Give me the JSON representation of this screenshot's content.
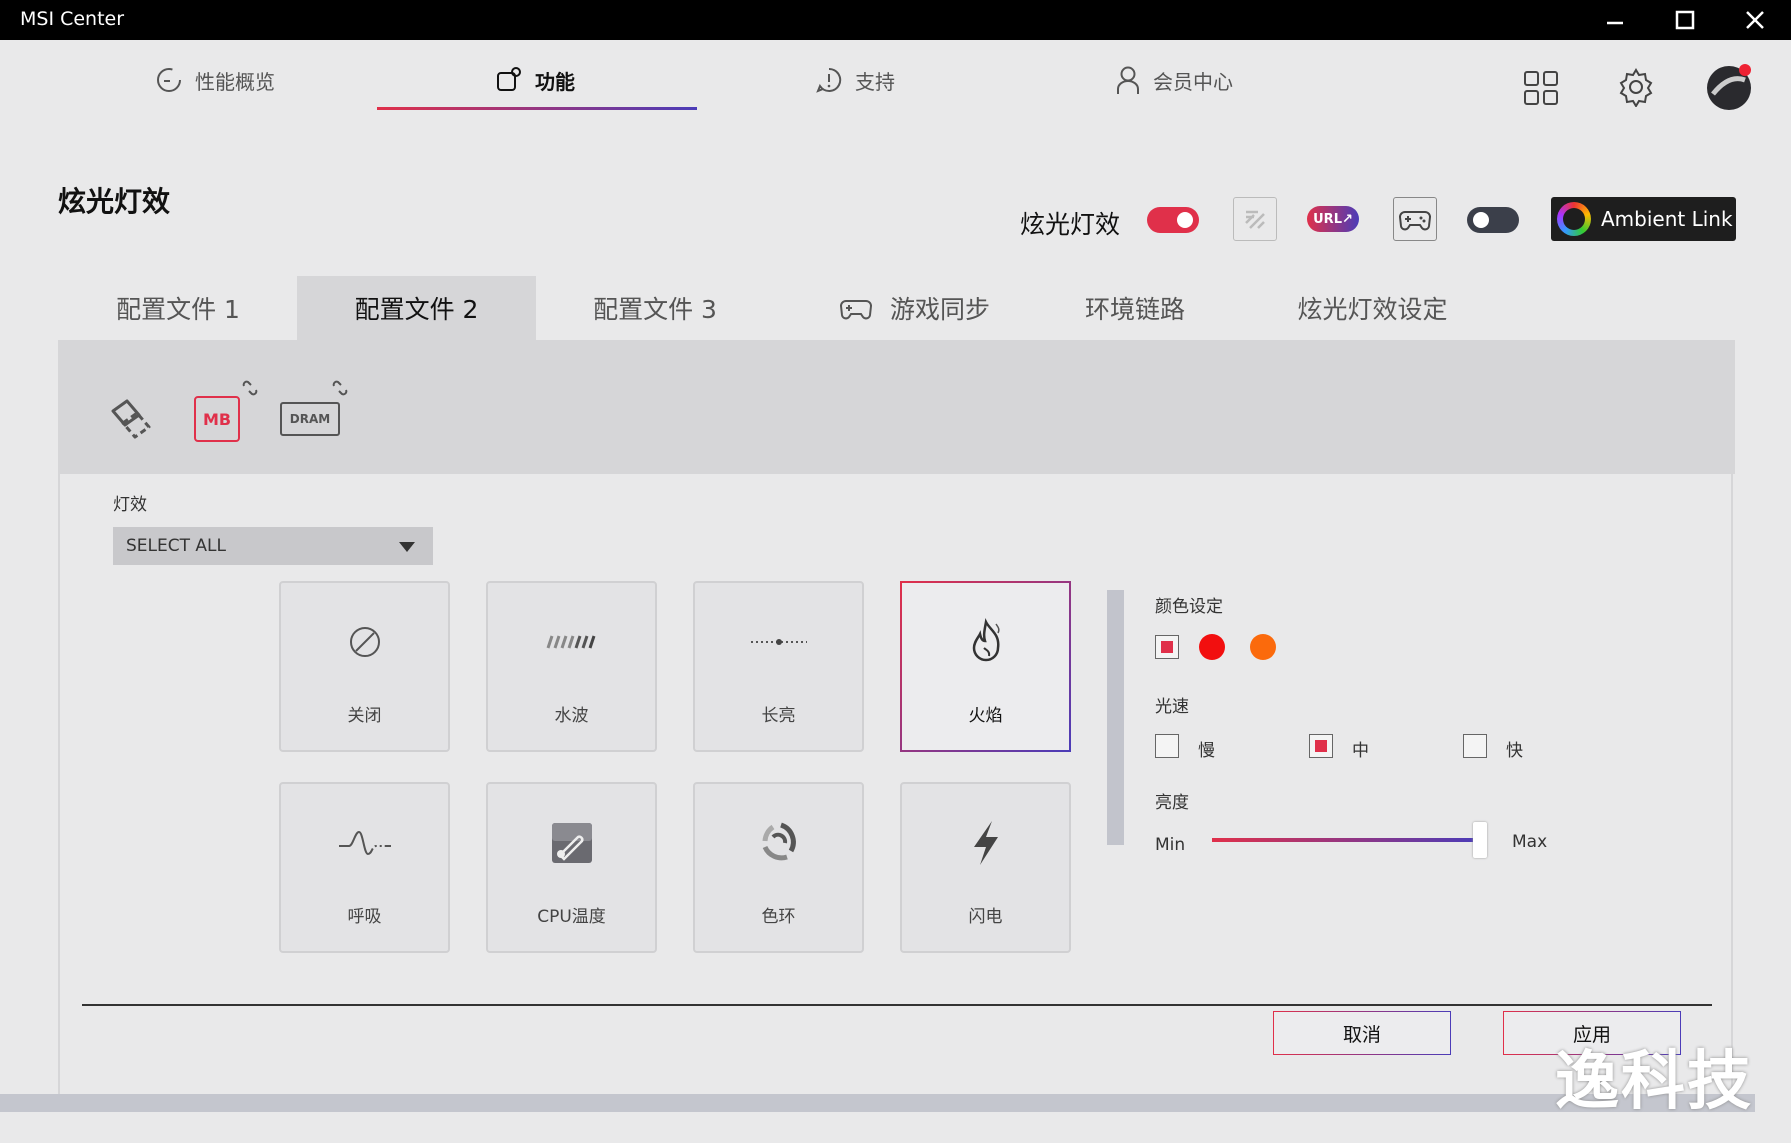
{
  "window": {
    "title": "MSI Center"
  },
  "nav": {
    "items": [
      {
        "label": "性能概览"
      },
      {
        "label": "功能"
      },
      {
        "label": "支持"
      },
      {
        "label": "会员中心"
      }
    ],
    "active_index": 1
  },
  "header": {
    "title": "炫光灯效",
    "toggle_label": "炫光灯效",
    "lighting_enabled": true,
    "second_toggle_enabled": false,
    "url_badge": "URL↗",
    "ambient_link_label": "Ambient Link"
  },
  "tabs": [
    {
      "label": "配置文件 1"
    },
    {
      "label": "配置文件 2"
    },
    {
      "label": "配置文件 3"
    },
    {
      "label": "游戏同步"
    },
    {
      "label": "环境链路"
    },
    {
      "label": "炫光灯效设定"
    }
  ],
  "active_tab_index": 1,
  "devices": [
    {
      "icon": "link-devices-icon"
    },
    {
      "icon": "motherboard-icon",
      "text": "MB"
    },
    {
      "icon": "dram-icon",
      "text": "DRAM"
    }
  ],
  "effects_section": {
    "label": "灯效",
    "select_value": "SELECT ALL",
    "effects": [
      {
        "label": "关闭",
        "icon": "off-icon"
      },
      {
        "label": "水波",
        "icon": "wave-icon"
      },
      {
        "label": "长亮",
        "icon": "steady-icon"
      },
      {
        "label": "火焰",
        "icon": "flame-icon",
        "selected": true
      },
      {
        "label": "呼吸",
        "icon": "breathing-icon"
      },
      {
        "label": "CPU温度",
        "icon": "cpu-temperature-icon"
      },
      {
        "label": "色环",
        "icon": "color-ring-icon"
      },
      {
        "label": "闪电",
        "icon": "lightning-icon"
      }
    ]
  },
  "settings": {
    "color_label": "颜色设定",
    "colors": [
      "#f20f0f",
      "#fb6a0c"
    ],
    "speed_label": "光速",
    "speed_options": [
      {
        "label": "慢",
        "checked": false
      },
      {
        "label": "中",
        "checked": true
      },
      {
        "label": "快",
        "checked": false
      }
    ],
    "brightness_label": "亮度",
    "min_label": "Min",
    "max_label": "Max",
    "brightness_value": 1.0
  },
  "actions": {
    "cancel": "取消",
    "apply": "应用"
  },
  "watermark": "逸科技",
  "accent": {
    "red": "#e0304a",
    "blue": "#4b3cb8"
  }
}
